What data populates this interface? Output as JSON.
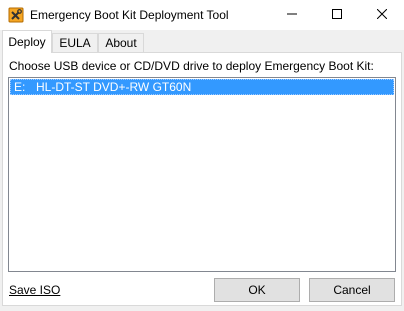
{
  "window": {
    "title": "Emergency Boot Kit Deployment Tool",
    "icon": "toolbox-icon",
    "controls": {
      "minimize": "minimize-icon",
      "maximize": "maximize-icon",
      "close": "close-icon"
    }
  },
  "tabs": [
    {
      "label": "Deploy",
      "active": true
    },
    {
      "label": "EULA",
      "active": false
    },
    {
      "label": "About",
      "active": false
    }
  ],
  "deploy": {
    "prompt": "Choose USB device or CD/DVD drive to deploy Emergency Boot Kit:",
    "devices": [
      {
        "drive": "E:",
        "name": "HL-DT-ST DVD+-RW GT60N",
        "selected": true
      }
    ]
  },
  "footer": {
    "save_iso": "Save ISO",
    "ok": "OK",
    "cancel": "Cancel"
  },
  "colors": {
    "selection": "#3399ff",
    "window_bg": "#f0f0f0",
    "panel_bg": "#ffffff"
  }
}
